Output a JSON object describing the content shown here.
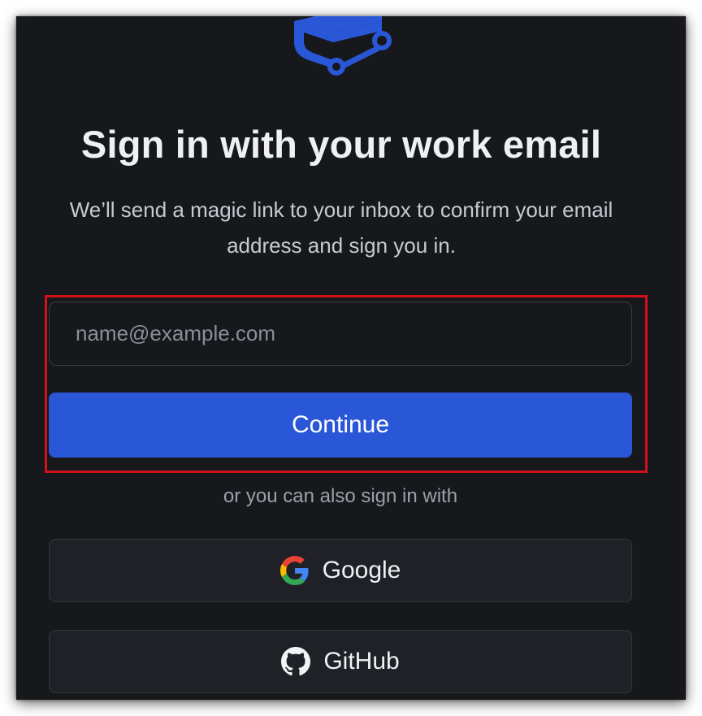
{
  "page": {
    "title": "Sign in with your work email",
    "subtitle": "We’ll send a magic link to your inbox to confirm your email address and sign you in."
  },
  "form": {
    "email_value": "",
    "email_placeholder": "name@example.com",
    "continue_label": "Continue"
  },
  "alternatives": {
    "divider_text": "or you can also sign in with",
    "providers": [
      {
        "label": "Google",
        "icon": "google-icon"
      },
      {
        "label": "GitHub",
        "icon": "github-icon"
      }
    ]
  },
  "colors": {
    "background": "#17181b",
    "accent": "#2a57d8",
    "highlight": "#d0101a",
    "logo": "#2a57d8"
  }
}
